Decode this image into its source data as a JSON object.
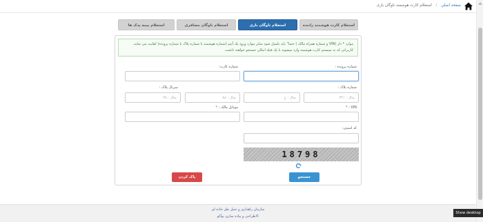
{
  "breadcrumb": {
    "home": "صفحه اصلي",
    "separator": "/",
    "current": "استعلام کارت هوشمند ناوگان باری"
  },
  "tabs": [
    {
      "label": "استعلام کارت هوشمند راننده",
      "active": false
    },
    {
      "label": "استعلام ناوگان باری",
      "active": true
    },
    {
      "label": "استعلام ناوگان مسافری",
      "active": false
    },
    {
      "label": "استعلام بیمه پدک ها",
      "active": false
    }
  ],
  "notice": {
    "line1": "موارد * دار (VIN و شماره همراه مالک ) حتما\" باید تکمیل شود سایر موارد ورود یک آیتم (شماره هوشمند یا شماره پلاک یا شماره پرونده) کفایت می نماید.",
    "line2": "کاربرانی که به سیستم کارت هوشمند وارد میشوند با یک فیلد امکان جستجو خواهند داشت."
  },
  "form": {
    "file_number_label": "شماره پرونده :",
    "card_number_label": "شماره کارت:",
    "plate_number_label": "شماره پلاک :",
    "plate_serial_label": "سریال پلاک :",
    "plate_1_placeholder": "مثال : ۳۲۱",
    "plate_2_placeholder": "مثال : ع",
    "plate_3_placeholder": "مثال : ۸۸",
    "plate_serial_placeholder": "مثال : ۳۸",
    "vin_label": "VIN :",
    "owner_mobile_label": "موبایل مالک :",
    "required_mark": "*",
    "security_code_label": "کد امنیتی:"
  },
  "captcha": {
    "text": "18798"
  },
  "buttons": {
    "search": "جستجو",
    "clear": "پاک کردن"
  },
  "footer": {
    "line1": "سازمان راهداری و حمل نقل جاده ای",
    "line2": "©طراحی و پیاده سازی نوآکو"
  },
  "tooltip": "Show desktop",
  "colors": {
    "active_tab": "#2d6fae",
    "search_button": "#3a93d1",
    "clear_button": "#d84848",
    "notice_text": "#3a7d37",
    "link": "#2a6fb5"
  },
  "icons": {
    "home": "home-icon",
    "refresh": "refresh-icon"
  }
}
